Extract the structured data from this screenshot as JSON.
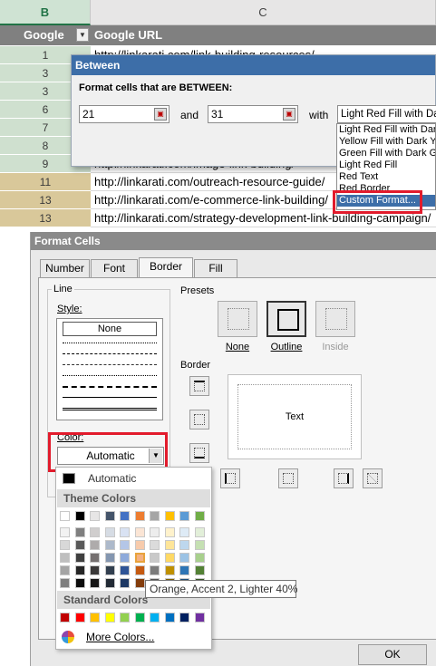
{
  "sheet": {
    "col_b": "B",
    "col_c": "C",
    "header_google": "Google",
    "header_url": "Google URL",
    "rows": [
      {
        "num": "1",
        "url": "http://linkarati.com/link-building-resources/",
        "bg": "#cfe0cf"
      },
      {
        "num": "3",
        "url": "",
        "bg": "#cfe0cf"
      },
      {
        "num": "3",
        "url": "",
        "bg": "#cfe0cf"
      },
      {
        "num": "6",
        "url": "",
        "bg": "#cfe0cf"
      },
      {
        "num": "7",
        "url": "",
        "bg": "#cfe0cf"
      },
      {
        "num": "8",
        "url": "",
        "bg": "#cfe0cf"
      },
      {
        "num": "9",
        "url": "http://linkarati.com/image-link-building/",
        "bg": "#cfe0cf"
      },
      {
        "num": "11",
        "url": "http://linkarati.com/outreach-resource-guide/",
        "bg": "#d9c89a"
      },
      {
        "num": "13",
        "url": "http://linkarati.com/e-commerce-link-building/",
        "bg": "#d9c89a"
      },
      {
        "num": "13",
        "url": "http://linkarati.com/strategy-development-link-building-campaign/",
        "bg": "#d9c89a"
      }
    ]
  },
  "between_dialog": {
    "title": "Between",
    "prompt": "Format cells that are BETWEEN:",
    "value_from": "21",
    "and_label": "and",
    "value_to": "31",
    "with_label": "with",
    "format_selected": "Light Red Fill with Dark Red Text",
    "format_options": [
      "Light Red Fill with Dark Red Text",
      "Yellow Fill with Dark Yellow Text",
      "Green Fill with Dark Green Text",
      "Light Red Fill",
      "Red Text",
      "Red Border",
      "Custom Format..."
    ]
  },
  "format_cells": {
    "title": "Format Cells",
    "tabs": [
      "Number",
      "Font",
      "Border",
      "Fill"
    ],
    "active_tab": "Border",
    "line_label": "Line",
    "style_label": "Style:",
    "style_none": "None",
    "color_label": "Color:",
    "color_value": "Automatic",
    "presets_label": "Presets",
    "preset_none": "None",
    "preset_outline": "Outline",
    "preset_inside": "Inside",
    "border_label": "Border",
    "preview_text": "Text",
    "ok_label": "OK"
  },
  "color_dropdown": {
    "automatic_label": "Automatic",
    "theme_colors_label": "Theme Colors",
    "standard_colors_label": "Standard Colors",
    "more_colors_label": "More Colors...",
    "tooltip": "Orange, Accent 2, Lighter 40%",
    "theme_top": [
      "#ffffff",
      "#000000",
      "#e7e6e6",
      "#44546a",
      "#4472c4",
      "#ed7d31",
      "#a5a5a5",
      "#ffc000",
      "#5b9bd5",
      "#70ad47"
    ],
    "theme_shades": [
      [
        "#f2f2f2",
        "#7f7f7f",
        "#d0cece",
        "#d6dce4",
        "#d9e2f3",
        "#fbe5d5",
        "#ededed",
        "#fff2cc",
        "#deebf6",
        "#e2efd9"
      ],
      [
        "#d8d8d8",
        "#595959",
        "#aeabab",
        "#adb9ca",
        "#b4c6e7",
        "#f7cbac",
        "#dbdbdb",
        "#fee599",
        "#bdd7ee",
        "#c5e0b3"
      ],
      [
        "#bfbfbf",
        "#3f3f3f",
        "#757070",
        "#8496b0",
        "#8eaadb",
        "#f4b183",
        "#c9c9c9",
        "#ffd965",
        "#9cc3e5",
        "#a8d08d"
      ],
      [
        "#a5a5a5",
        "#262626",
        "#3a3838",
        "#323f4f",
        "#2f5496",
        "#c55a11",
        "#7b7b7b",
        "#bf9000",
        "#2e75b5",
        "#538135"
      ],
      [
        "#7f7f7f",
        "#0c0c0c",
        "#171616",
        "#222a35",
        "#1e3864",
        "#833c0b",
        "#525252",
        "#7f6000",
        "#1e4e79",
        "#375623"
      ]
    ],
    "standard": [
      "#c00000",
      "#ff0000",
      "#ffc000",
      "#ffff00",
      "#92d050",
      "#00b050",
      "#00b0f0",
      "#0070c0",
      "#002060",
      "#7030a0"
    ]
  }
}
